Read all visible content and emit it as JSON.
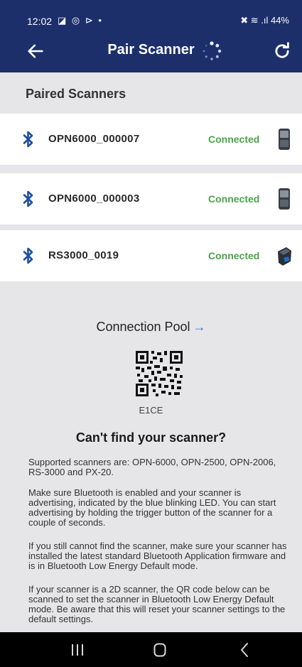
{
  "status_bar": {
    "time": "12:02",
    "left_icons": "◪ ◎ ⊳ •",
    "right": "✖ ≋ .ıl 44%",
    "battery_percent": "44%"
  },
  "app_bar": {
    "title": "Pair Scanner",
    "back_icon": "arrow-left-icon",
    "refresh_icon": "refresh-icon",
    "spinner_icon": "loading-spinner-icon"
  },
  "paired_section": {
    "title": "Paired Scanners"
  },
  "scanners": [
    {
      "name": "OPN6000_000007",
      "status": "Connected",
      "icon": "bluetooth-icon",
      "device": "opn-scanner"
    },
    {
      "name": "OPN6000_000003",
      "status": "Connected",
      "icon": "bluetooth-icon",
      "device": "opn-scanner"
    },
    {
      "name": "RS3000_0019",
      "status": "Connected",
      "icon": "bluetooth-icon",
      "device": "rs-scanner"
    }
  ],
  "pool": {
    "label": "Connection Pool",
    "arrow": "→",
    "code": "E1CE"
  },
  "help": {
    "heading": "Can't find your scanner?",
    "paragraphs": [
      "Supported scanners are: OPN-6000, OPN-2500, OPN-2006, RS-3000 and PX-20.",
      "Make sure Bluetooth is enabled and your scanner is advertising, indicated by the blue blinking LED. You can start advertising by holding the trigger button of the scanner for a couple of seconds.",
      "If you still cannot find the scanner, make sure your scanner has installed the latest standard Bluetooth Application firmware and is in Bluetooth Low Energy Default mode.",
      "If your scanner is a 2D scanner, the QR code below can be scanned to set the scanner in Bluetooth Low Energy Default mode. Be aware that this will reset your scanner settings to the default settings."
    ]
  },
  "colors": {
    "header": "#1d2f6b",
    "connected": "#4ba34b",
    "bluetooth": "#1f4fa0",
    "link_arrow": "#3a6fd8"
  }
}
